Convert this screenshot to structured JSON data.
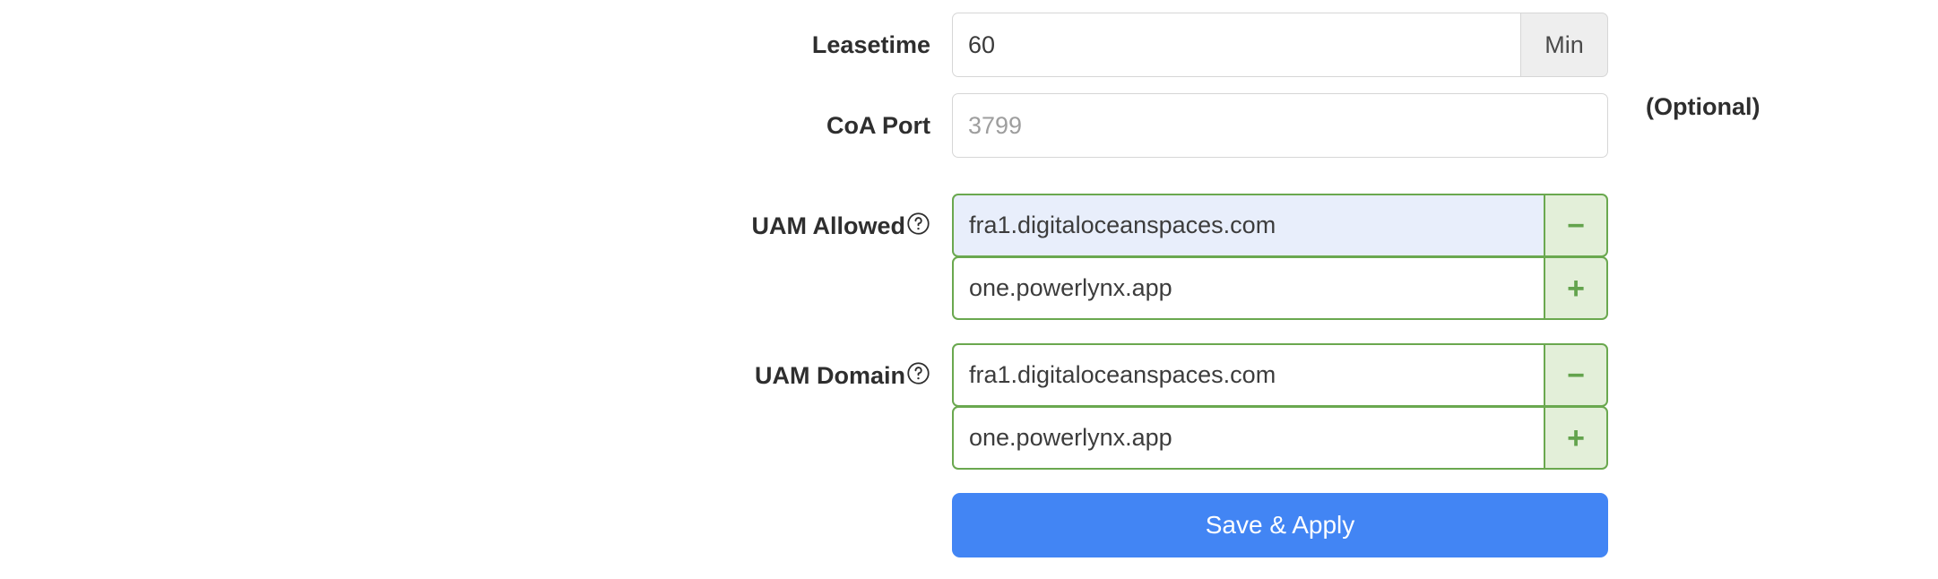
{
  "form": {
    "fields": [
      {
        "id": "leasetime",
        "label": "Leasetime",
        "value": "60",
        "placeholder": "",
        "addon": "Min"
      },
      {
        "id": "coa_port",
        "label": "CoA Port",
        "value": "",
        "placeholder": "3799",
        "suffix": "(Optional)"
      },
      {
        "id": "uam_allowed",
        "label": "UAM Allowed",
        "help_icon": "?",
        "items": [
          {
            "value": "fra1.digitaloceanspaces.com",
            "button": "−",
            "button_name": "remove",
            "autofilled": true
          },
          {
            "value": "one.powerlynx.app",
            "button": "+",
            "button_name": "add",
            "autofilled": false
          }
        ]
      },
      {
        "id": "uam_domain",
        "label": "UAM Domain",
        "help_icon": "?",
        "items": [
          {
            "value": "fra1.digitaloceanspaces.com",
            "button": "−",
            "button_name": "remove",
            "autofilled": false
          },
          {
            "value": "one.powerlynx.app",
            "button": "+",
            "button_name": "add",
            "autofilled": false
          }
        ]
      }
    ],
    "submit_label": "Save & Apply"
  },
  "colors": {
    "accent_blue": "#4285f4",
    "list_border_green": "#6aa84f",
    "list_button_bg": "#e3efd9",
    "autofill_blue": "#e8eefb",
    "label_text": "#2e2e2e",
    "input_border": "#d6d6d6",
    "addon_bg": "#eeeeee"
  }
}
